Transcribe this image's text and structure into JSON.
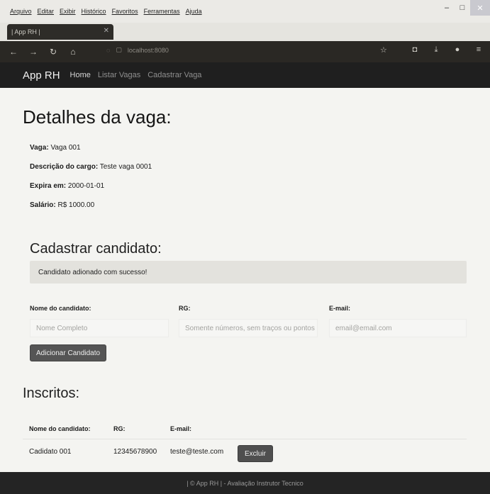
{
  "browser": {
    "menu": [
      "Arquivo",
      "Editar",
      "Exibir",
      "Histórico",
      "Favoritos",
      "Ferramentas",
      "Ajuda"
    ],
    "tab_title": "| App RH |",
    "url": "localhost:8080"
  },
  "header": {
    "brand": "App RH",
    "nav": [
      "Home",
      "Listar Vagas",
      "Cadastrar Vaga"
    ]
  },
  "page": {
    "title": "Detalhes da vaga:",
    "details": [
      {
        "label": "Vaga:",
        "value": "Vaga 001"
      },
      {
        "label": "Descrição do cargo:",
        "value": "Teste vaga 0001"
      },
      {
        "label": "Expira em:",
        "value": "2000-01-01"
      },
      {
        "label": "Salário:",
        "value": "R$ 1000.00"
      }
    ]
  },
  "form": {
    "title": "Cadastrar candidato:",
    "alert": "Candidato adionado com sucesso!",
    "name_label": "Nome do candidato:",
    "name_placeholder": "Nome Completo",
    "rg_label": "RG:",
    "rg_placeholder": "Somente números, sem traços ou pontos",
    "email_label": "E-mail:",
    "email_placeholder": "email@email.com",
    "submit": "Adicionar Candidato"
  },
  "inscritos": {
    "title": "Inscritos:",
    "columns": [
      "Nome do candidato:",
      "RG:",
      "E-mail:"
    ],
    "rows": [
      {
        "nome": "Cadidato 001",
        "rg": "12345678900",
        "email": "teste@teste.com",
        "action": "Excluir"
      }
    ]
  },
  "footer": "| © App RH | - Avaliação Instrutor Tecnico"
}
